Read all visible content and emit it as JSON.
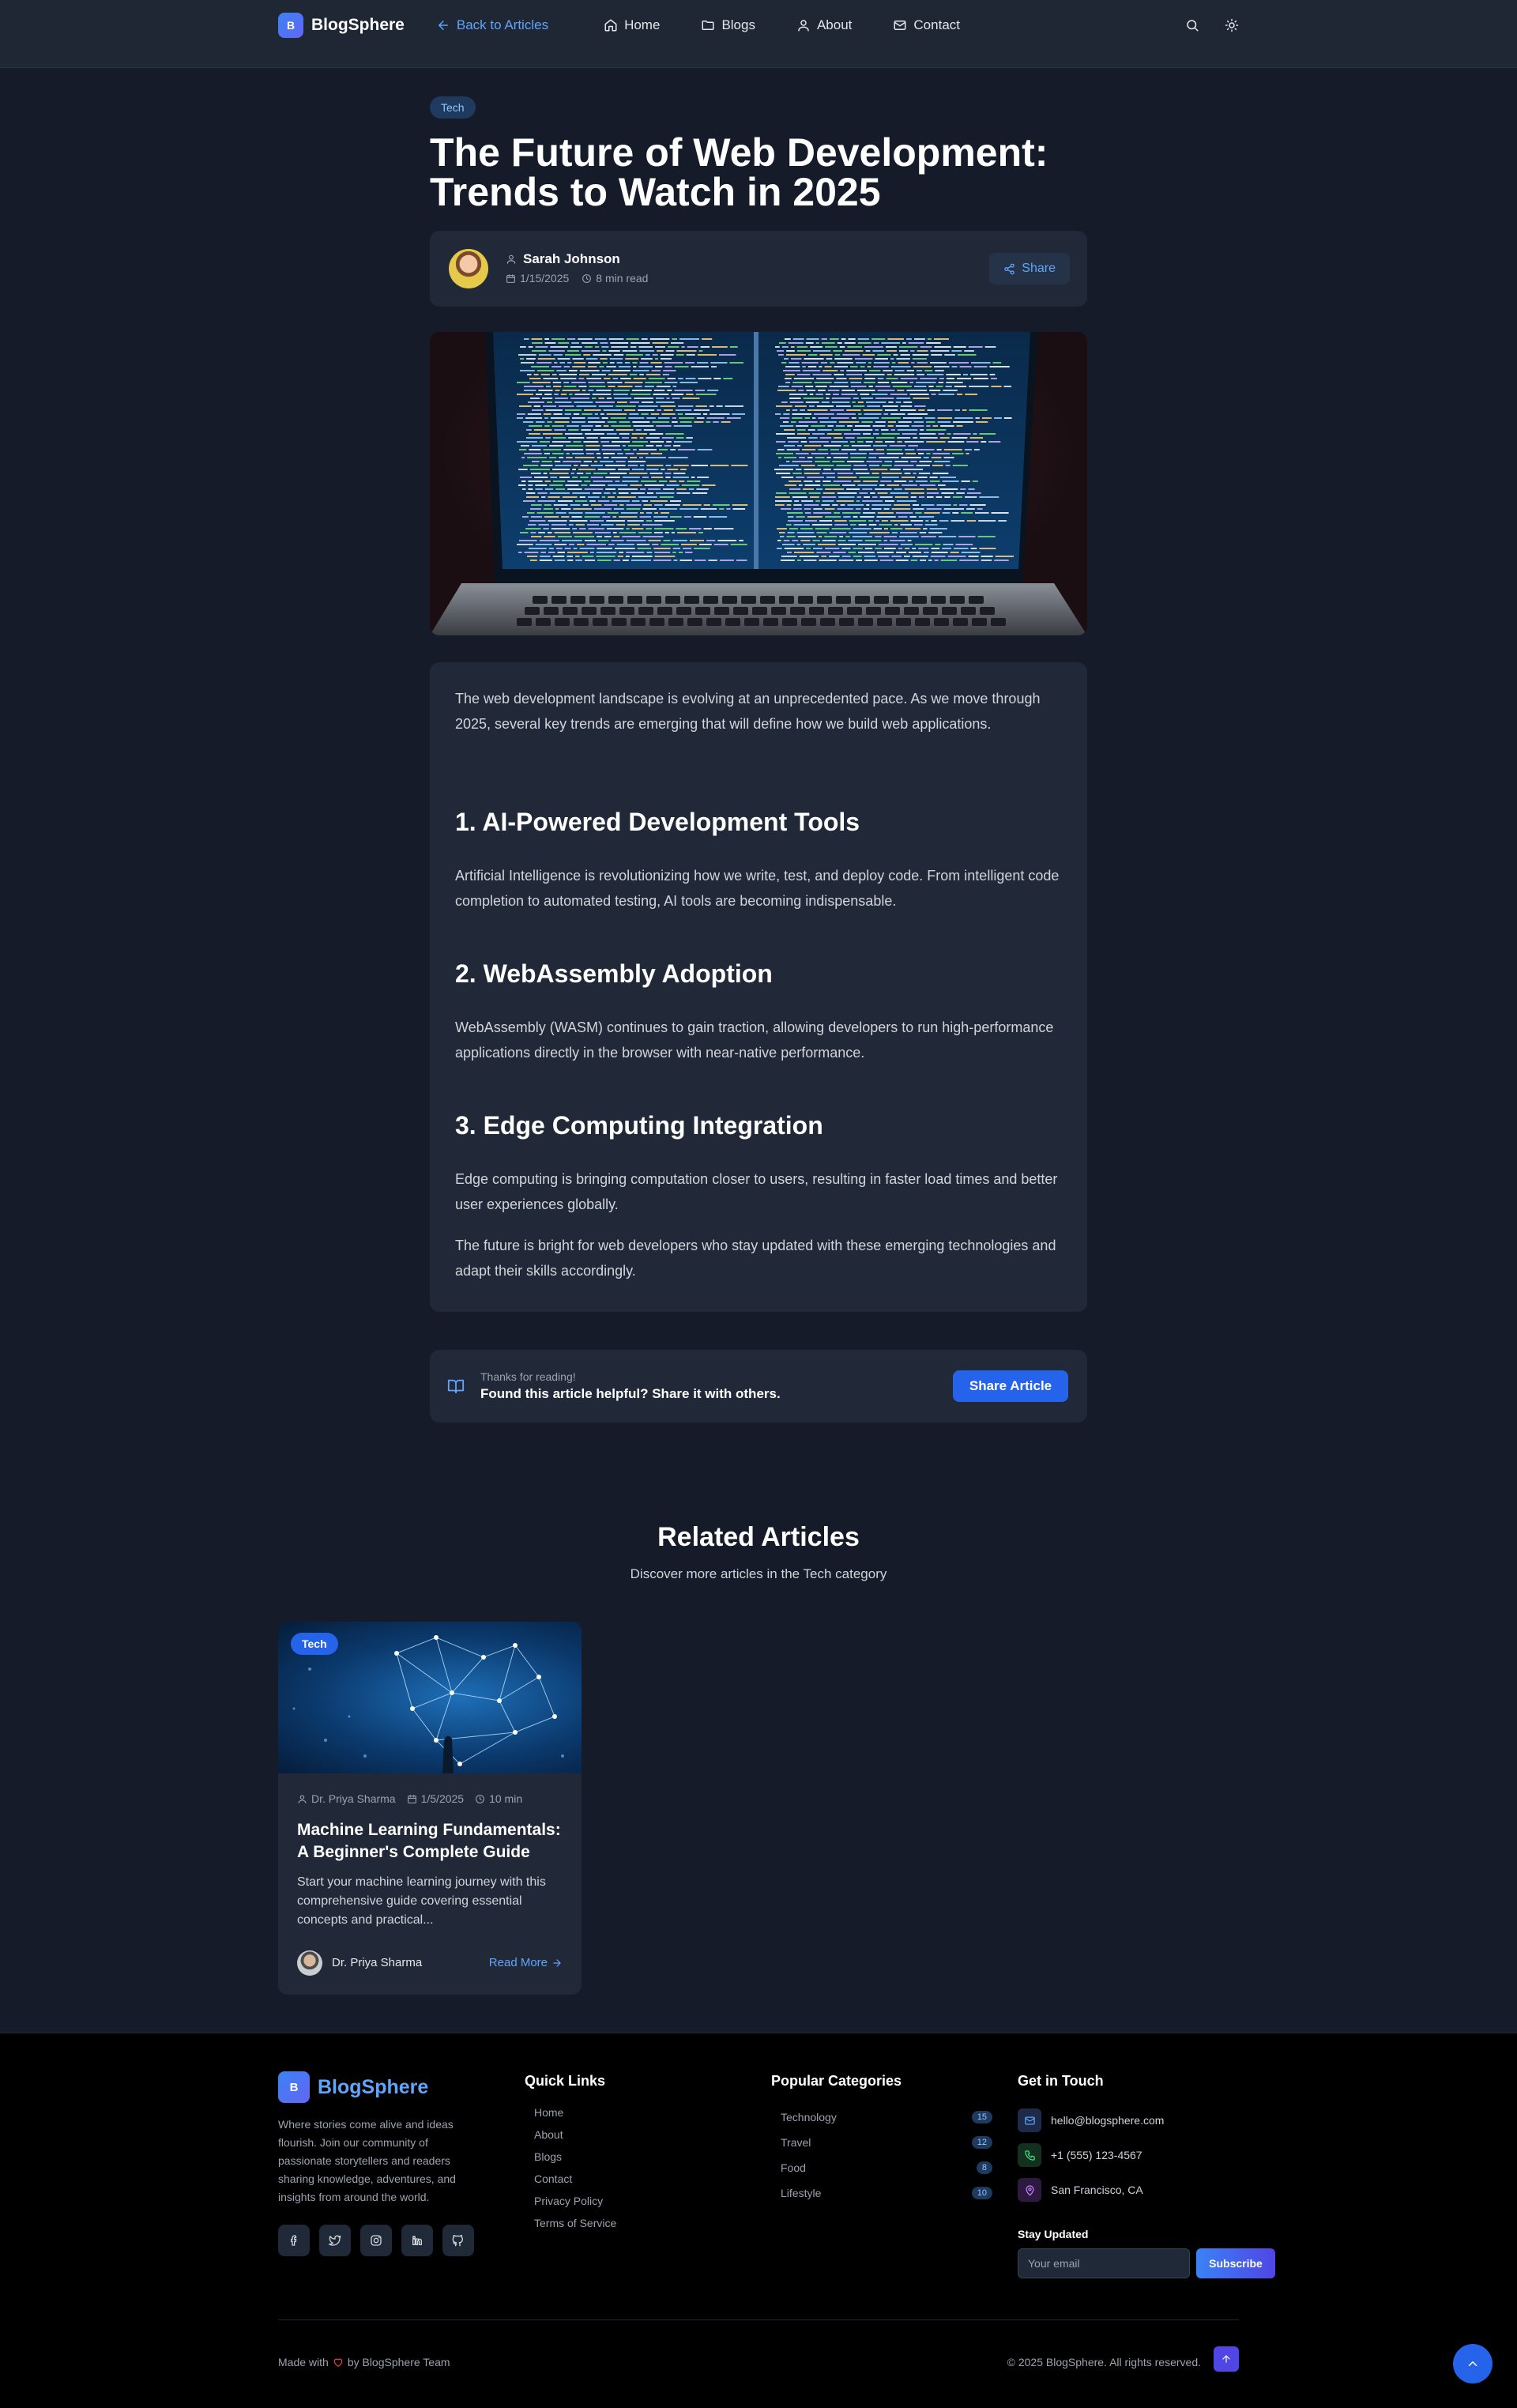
{
  "nav": {
    "logo_letter": "B",
    "brand": "BlogSphere",
    "back_label": "Back to Articles",
    "links": [
      {
        "label": "Home",
        "icon": "home-icon"
      },
      {
        "label": "Blogs",
        "icon": "folder-icon"
      },
      {
        "label": "About",
        "icon": "user-icon"
      },
      {
        "label": "Contact",
        "icon": "mail-icon"
      }
    ]
  },
  "article": {
    "category": "Tech",
    "title": "The Future of Web Development: Trends to Watch in 2025",
    "author": "Sarah Johnson",
    "date": "1/15/2025",
    "read_time": "8 min read",
    "share_label": "Share",
    "intro": "The web development landscape is evolving at an unprecedented pace. As we move through 2025, several key trends are emerging that will define how we build web applications.",
    "sections": [
      {
        "heading": "1. AI-Powered Development Tools",
        "text": "Artificial Intelligence is revolutionizing how we write, test, and deploy code. From intelligent code completion to automated testing, AI tools are becoming indispensable."
      },
      {
        "heading": "2. WebAssembly Adoption",
        "text": "WebAssembly (WASM) continues to gain traction, allowing developers to run high-performance applications directly in the browser with near-native performance."
      },
      {
        "heading": "3. Edge Computing Integration",
        "text": "Edge computing is bringing computation closer to users, resulting in faster load times and better user experiences globally."
      }
    ],
    "conclusion": "The future is bright for web developers who stay updated with these emerging technologies and adapt their skills accordingly."
  },
  "thanks": {
    "small": "Thanks for reading!",
    "big": "Found this article helpful? Share it with others.",
    "button": "Share Article"
  },
  "related": {
    "title": "Related Articles",
    "subtitle": "Discover more articles in the Tech category",
    "cards": [
      {
        "tag": "Tech",
        "author": "Dr. Priya Sharma",
        "date": "1/5/2025",
        "read_time": "10 min",
        "title": "Machine Learning Fundamentals: A Beginner's Complete Guide",
        "desc": "Start your machine learning journey with this comprehensive guide covering essential concepts and practical...",
        "read_more": "Read More"
      }
    ]
  },
  "footer": {
    "brand": "BlogSphere",
    "logo_letter": "B",
    "about": "Where stories come alive and ideas flourish. Join our community of passionate storytellers and readers sharing knowledge, adventures, and insights from around the world.",
    "quick_links_title": "Quick Links",
    "quick_links": [
      "Home",
      "About",
      "Blogs",
      "Contact",
      "Privacy Policy",
      "Terms of Service"
    ],
    "categories_title": "Popular Categories",
    "categories": [
      {
        "name": "Technology",
        "count": "15"
      },
      {
        "name": "Travel",
        "count": "12"
      },
      {
        "name": "Food",
        "count": "8"
      },
      {
        "name": "Lifestyle",
        "count": "10"
      }
    ],
    "contact_title": "Get in Touch",
    "email": "hello@blogsphere.com",
    "phone": "+1 (555) 123-4567",
    "location": "San Francisco, CA",
    "stay_updated": "Stay Updated",
    "email_placeholder": "Your email",
    "subscribe": "Subscribe",
    "made_with_prefix": "Made with",
    "made_with_suffix": "by BlogSphere Team",
    "copyright": "© 2025 BlogSphere. All rights reserved."
  },
  "colors": {
    "background": "#151b29",
    "card": "#212938",
    "accent": "#2563eb",
    "link": "#60a5fa",
    "footer": "#000000"
  }
}
